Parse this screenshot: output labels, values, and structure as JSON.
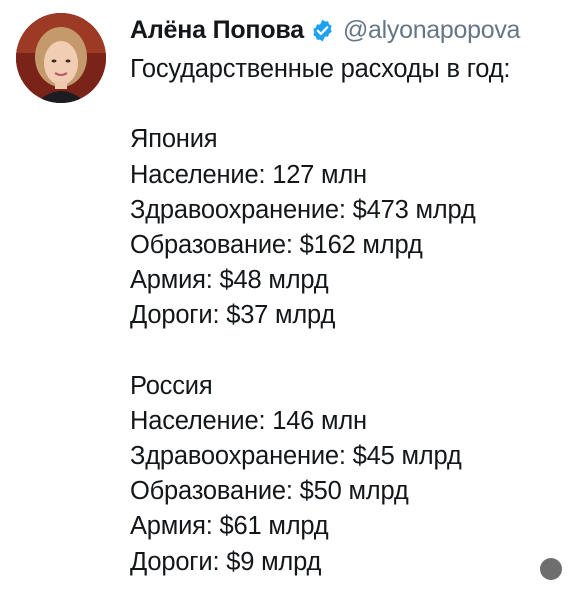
{
  "author": {
    "display_name": "Алёна Попова",
    "handle": "@alyonapopova",
    "avatar_icon": "profile-photo",
    "verified_icon": "verified-badge-icon",
    "verified_color": "#1da1f2"
  },
  "tweet": {
    "intro": "Государственные расходы в год:",
    "sections": [
      {
        "country": "Япония",
        "lines": [
          "Население: 127 млн",
          "Здравоохранение: $473 млрд",
          "Образование: $162 млрд",
          "Армия: $48 млрд",
          "Дороги: $37 млрд"
        ]
      },
      {
        "country": "Россия",
        "lines": [
          "Население: 146 млн",
          "Здравоохранение: $45 млрд",
          "Образование: $50 млрд",
          "Армия: $61 млрд",
          "Дороги: $9 млрд"
        ]
      }
    ]
  },
  "colors": {
    "text": "#14171a",
    "muted": "#657786"
  }
}
